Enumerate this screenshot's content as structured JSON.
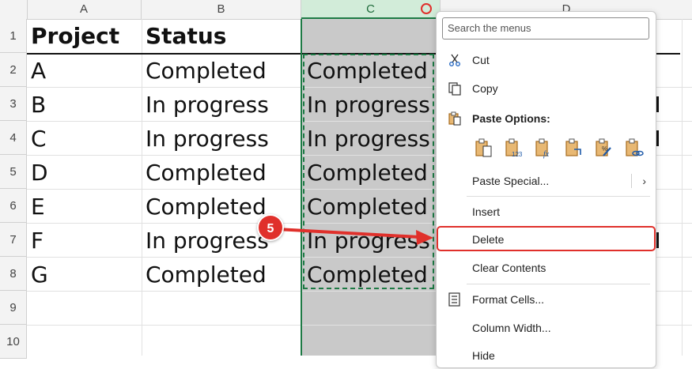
{
  "columns": [
    "A",
    "B",
    "C",
    "D"
  ],
  "rows": [
    "1",
    "2",
    "3",
    "4",
    "5",
    "6",
    "7",
    "8",
    "9",
    "10"
  ],
  "table": {
    "headers": [
      "Project",
      "Status"
    ],
    "projects": [
      "A",
      "B",
      "C",
      "D",
      "E",
      "F",
      "G"
    ],
    "statuses": [
      "Completed",
      "In progress",
      "In progress",
      "Completed",
      "Completed",
      "In progress",
      "Completed"
    ],
    "copied": [
      "Completed",
      "In progress",
      "In progress",
      "Completed",
      "Completed",
      "In progress",
      "Completed"
    ]
  },
  "menu": {
    "search_placeholder": "Search the menus",
    "items": {
      "cut": "Cut",
      "copy": "Copy",
      "paste_options": "Paste Options:",
      "paste_special": "Paste Special...",
      "insert": "Insert",
      "delete": "Delete",
      "clear_contents": "Clear Contents",
      "format_cells": "Format Cells...",
      "column_width": "Column Width...",
      "hide": "Hide"
    }
  },
  "annotation": {
    "step": "5"
  },
  "colors": {
    "accent": "#1e7a45",
    "annotation": "#e0302b"
  }
}
